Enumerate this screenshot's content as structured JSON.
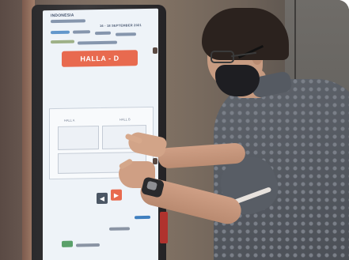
{
  "photo": {
    "scene": "",
    "screen": {
      "header_lines": [
        "INDONESIA",
        "16 - 18 SEPTEMBER 2021"
      ],
      "hall_button_label": "HALLA - D",
      "map": {
        "title": "",
        "labels": [
          "HALL A",
          "HALL B"
        ]
      },
      "nav_icons": [
        "arrow-left-icon",
        "arrow-right-icon"
      ]
    }
  },
  "colors": {
    "hall_button": "#e86a4f",
    "screen_bg": "#eef3f8",
    "mask": "#1e1e22",
    "shirt": "#555a62"
  }
}
